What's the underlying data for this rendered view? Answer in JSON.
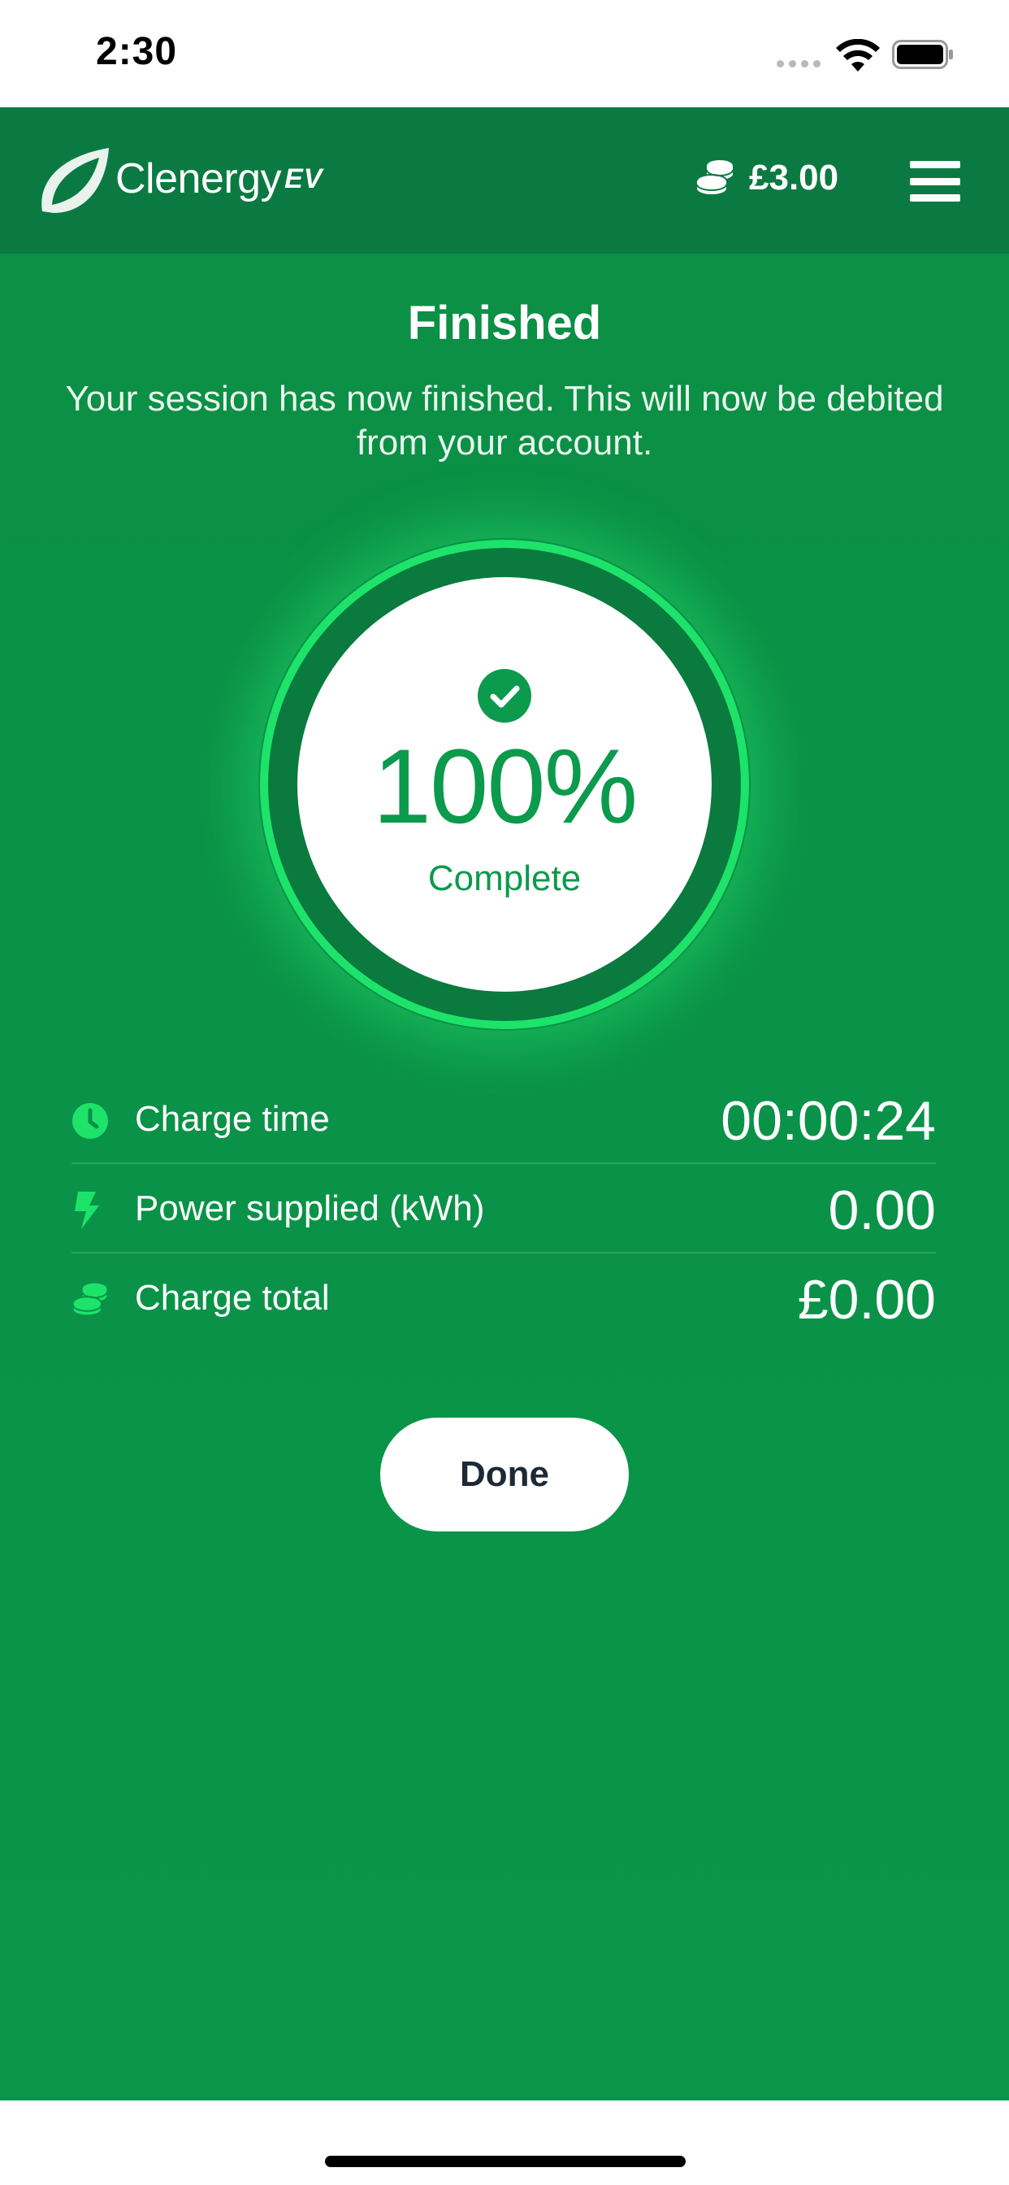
{
  "status_bar": {
    "time": "2:30",
    "wifi_icon": "wifi-icon",
    "battery_icon": "battery-icon"
  },
  "header": {
    "logo_text": "Clenergy",
    "logo_suffix": "EV",
    "balance": "£3.00",
    "balance_icon": "coins-icon",
    "menu_icon": "hamburger-menu-icon"
  },
  "session": {
    "title": "Finished",
    "message": "Your session has now finished. This will now be debited from your account.",
    "progress_percent": "100%",
    "progress_value": 1.0,
    "progress_label": "Complete",
    "status_icon": "check-circle-icon"
  },
  "stats": [
    {
      "icon": "clock-icon",
      "label": "Charge time",
      "value": "00:00:24"
    },
    {
      "icon": "lightning-bolt-icon",
      "label": "Power supplied (kWh)",
      "value": "0.00"
    },
    {
      "icon": "coins-icon",
      "label": "Charge total",
      "value": "£0.00"
    }
  ],
  "actions": {
    "done_label": "Done"
  },
  "colors": {
    "primary_green": "#0b8f45",
    "header_green": "#0b7a42",
    "ring_glow": "#1de36a",
    "text_green": "#0c9a4c",
    "icon_green": "#1de36a",
    "button_text": "#1b2a36"
  }
}
